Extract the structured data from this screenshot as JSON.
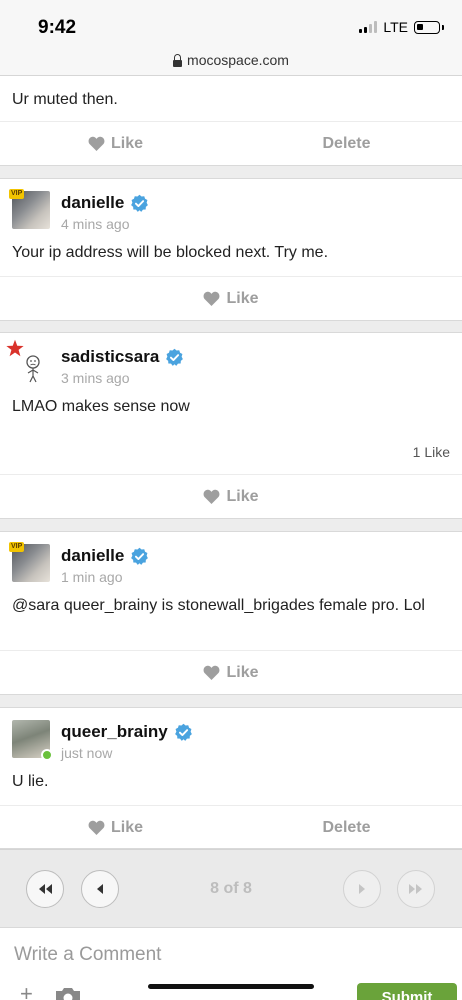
{
  "status_bar": {
    "time": "9:42",
    "network": "LTE",
    "battery_level": 0.3
  },
  "url_bar": {
    "domain": "mocospace.com"
  },
  "colors": {
    "verified": "#4aa3df",
    "submit": "#6aa33a",
    "online": "#6ac13c",
    "action_text": "#9e9e9e"
  },
  "top_partial": {
    "text": "Ur muted then.",
    "like_label": "Like",
    "delete_label": "Delete"
  },
  "comments": [
    {
      "username": "danielle",
      "time": "4 mins ago",
      "text": "Your ip address will be blocked next. Try me.",
      "badge": "VIP",
      "like_label": "Like"
    },
    {
      "username": "sadisticsara",
      "time": "3 mins ago",
      "text": "LMAO makes sense now",
      "like_count": "1 Like",
      "like_label": "Like"
    },
    {
      "username": "danielle",
      "time": "1 min ago",
      "text": "@sara queer_brainy is stonewall_brigades female pro. Lol",
      "badge": "VIP",
      "like_label": "Like"
    },
    {
      "username": "queer_brainy",
      "time": "just now",
      "text": "U lie.",
      "like_label": "Like",
      "delete_label": "Delete"
    }
  ],
  "pager": {
    "current_page": 8,
    "total_pages": 8,
    "indicator": "8 of 8"
  },
  "comment_box": {
    "placeholder": "Write a Comment",
    "submit_label": "Submit"
  }
}
